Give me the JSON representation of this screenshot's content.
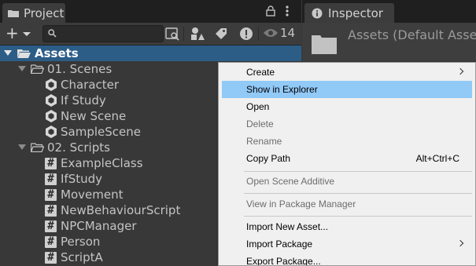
{
  "project": {
    "tab_label": "Project",
    "search_placeholder": "",
    "hidden_packages_count": "14",
    "tree": {
      "root": "Assets",
      "folders": [
        {
          "label": "01. Scenes",
          "items": [
            "Character",
            "If Study",
            "New Scene",
            "SampleScene"
          ]
        },
        {
          "label": "02. Scripts",
          "items": [
            "ExampleClass",
            "IfStudy",
            "Movement",
            "NewBehaviourScript",
            "NPCManager",
            "Person",
            "ScriptA"
          ]
        }
      ]
    }
  },
  "inspector": {
    "tab_label": "Inspector",
    "title": "Assets (Default Asse"
  },
  "context_menu": {
    "items": [
      {
        "label": "Create",
        "submenu": true,
        "enabled": true
      },
      {
        "label": "Show in Explorer",
        "enabled": true,
        "highlighted": true
      },
      {
        "label": "Open",
        "enabled": true
      },
      {
        "label": "Delete",
        "enabled": false
      },
      {
        "label": "Rename",
        "enabled": false
      },
      {
        "label": "Copy Path",
        "enabled": true,
        "shortcut": "Alt+Ctrl+C"
      },
      {
        "label": "Open Scene Additive",
        "enabled": false
      },
      {
        "label": "View in Package Manager",
        "enabled": false
      },
      {
        "label": "Import New Asset...",
        "enabled": true
      },
      {
        "label": "Import Package",
        "enabled": true,
        "submenu": true
      },
      {
        "label": "Export Package...",
        "enabled": true
      }
    ]
  },
  "colors": {
    "panel_bg": "#383838",
    "tab_bar_bg": "#1f1f1f",
    "selection_bg": "#2c5d87",
    "menu_bg": "#f0f0f0",
    "menu_highlight": "#91c9f7",
    "menu_disabled_text": "#6d6d6d"
  },
  "icons": {
    "project_tab": "folder-icon",
    "inspector_tab": "info-icon",
    "toolbar": [
      "search-by-type-icon",
      "scene-filter-icon",
      "label-filter-icon",
      "error-filter-icon",
      "hidden-packages-eye-icon"
    ],
    "scene": "unity-scene-icon",
    "script": "csharp-script-icon"
  }
}
